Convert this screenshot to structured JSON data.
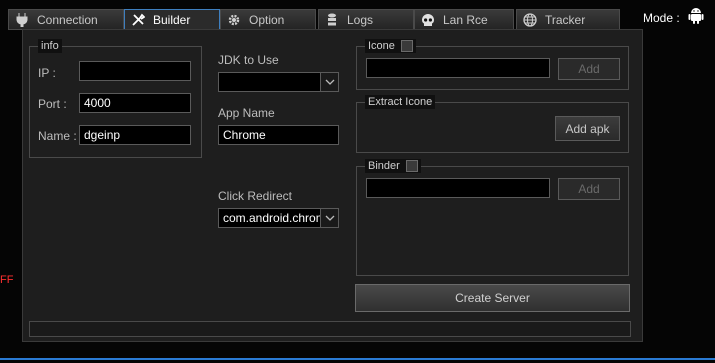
{
  "tabs": [
    {
      "label": "Connection",
      "icon": "plug-icon",
      "active": false
    },
    {
      "label": "Builder",
      "icon": "tools-icon",
      "active": true
    },
    {
      "label": "Option",
      "icon": "gear-icon",
      "active": false
    },
    {
      "label": "Logs",
      "icon": "database-icon",
      "active": false
    },
    {
      "label": "Lan Rce",
      "icon": "skull-icon",
      "active": false
    },
    {
      "label": "Tracker",
      "icon": "globe-icon",
      "active": false
    }
  ],
  "mode": {
    "label": "Mode :",
    "icon": "android-icon"
  },
  "left_edge_text": "FF",
  "info": {
    "legend": "info",
    "ip_label": "IP :",
    "ip_value": "",
    "port_label": "Port :",
    "port_value": "4000",
    "name_label": "Name :",
    "name_value": "dgeinp"
  },
  "jdk": {
    "label": "JDK to Use",
    "value": ""
  },
  "app_name": {
    "label": "App Name",
    "value": "Chrome"
  },
  "click_redirect": {
    "label": "Click Redirect",
    "value": "com.android.chrome"
  },
  "icone": {
    "legend": "Icone",
    "value": "",
    "add_label": "Add"
  },
  "extract_icone": {
    "legend": "Extract Icone",
    "add_apk_label": "Add apk"
  },
  "binder": {
    "legend": "Binder",
    "value": "",
    "add_label": "Add"
  },
  "create_server_label": "Create Server",
  "progress": 0,
  "colors": {
    "accent": "#2a7bd4",
    "active_tab_border": "#3e7fbf"
  }
}
